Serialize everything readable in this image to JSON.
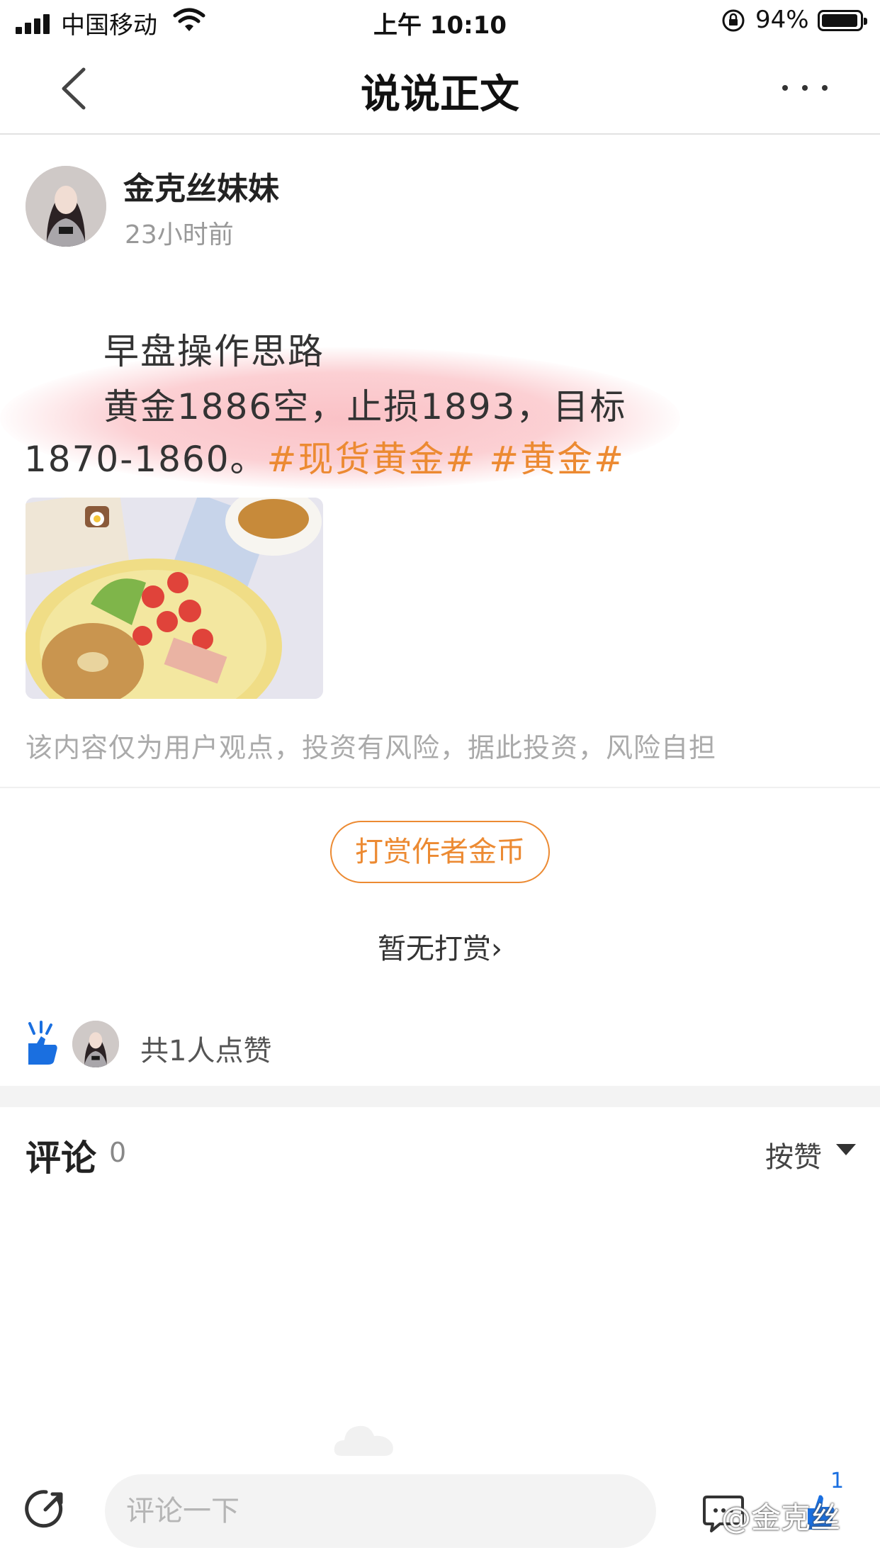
{
  "status_bar": {
    "carrier": "中国移动",
    "time": "上午 10:10",
    "battery": "94%",
    "battery_level": 0.94,
    "icons": [
      "signal-icon",
      "wifi-icon",
      "orientation-lock-icon",
      "battery-icon"
    ]
  },
  "nav": {
    "title": "说说正文",
    "back_icon": "chevron-left-icon",
    "more_icon": "more-dots-icon"
  },
  "post": {
    "author": "金克丝妹妹",
    "time_ago": "23小时前",
    "line1": "早盘操作思路",
    "line2": "黄金1886空，止损1893，目标",
    "line3_text": "1870-1860。",
    "tags": [
      "#现货黄金#",
      "#黄金#"
    ],
    "disclaimer": "该内容仅为用户观点，投资有风险，据此投资，风险自担"
  },
  "reward": {
    "button": "打赏作者金币",
    "status": "暂无打赏",
    "status_arrow": "›"
  },
  "likes": {
    "text": "共1人点赞",
    "icon": "thumbs-up-icon"
  },
  "comments": {
    "title": "评论",
    "count": "0",
    "sort": "按赞"
  },
  "bottom_bar": {
    "placeholder": "评论一下",
    "like_badge": "1",
    "watermark": "@金克丝",
    "icons": [
      "share-icon",
      "chat-icon",
      "thumbs-up-icon"
    ]
  },
  "colors": {
    "accent": "#ec8a32",
    "like_blue": "#1a6fe0",
    "highlight": "#f57882"
  }
}
